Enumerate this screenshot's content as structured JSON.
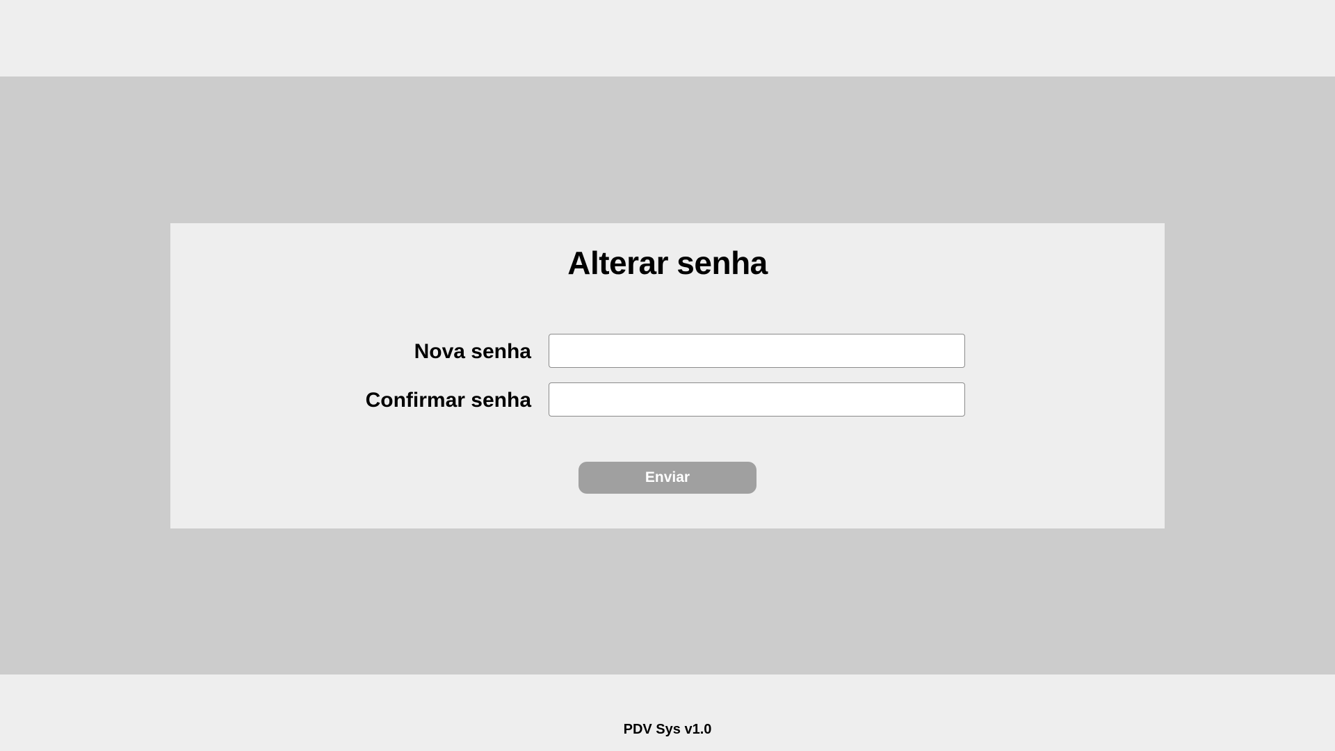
{
  "app": {
    "background_color": "#eeeeee",
    "content_background_color": "#cccccc"
  },
  "form": {
    "title": "Alterar senha",
    "fields": [
      {
        "label": "Nova senha",
        "value": "",
        "placeholder": ""
      },
      {
        "label": "Confirmar senha",
        "value": "",
        "placeholder": ""
      }
    ],
    "submit_label": "Enviar",
    "submit_color": "#a0a0a0"
  },
  "footer": {
    "text": "PDV Sys v1.0"
  }
}
